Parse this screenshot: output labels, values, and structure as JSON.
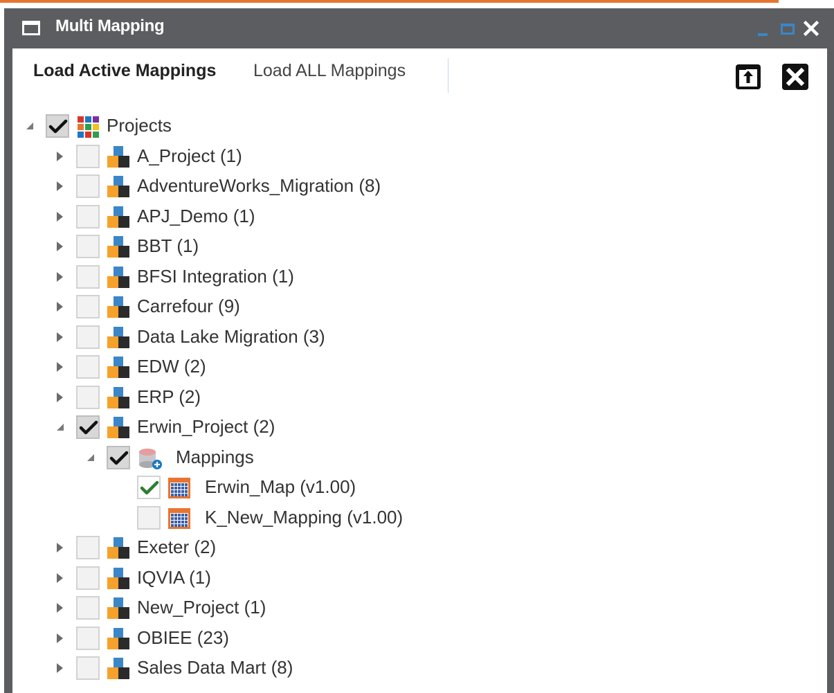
{
  "window": {
    "title": "Multi Mapping"
  },
  "tabs": {
    "active": "Load Active Mappings",
    "inactive": "Load ALL Mappings"
  },
  "tree": {
    "root": {
      "label": "Projects",
      "checked": true,
      "expanded": true
    },
    "projects": [
      {
        "label": "A_Project (1)",
        "checked": false,
        "expanded": false
      },
      {
        "label": "AdventureWorks_Migration (8)",
        "checked": false,
        "expanded": false
      },
      {
        "label": "APJ_Demo (1)",
        "checked": false,
        "expanded": false
      },
      {
        "label": "BBT (1)",
        "checked": false,
        "expanded": false
      },
      {
        "label": "BFSI Integration (1)",
        "checked": false,
        "expanded": false
      },
      {
        "label": "Carrefour (9)",
        "checked": false,
        "expanded": false
      },
      {
        "label": "Data Lake Migration (3)",
        "checked": false,
        "expanded": false
      },
      {
        "label": "EDW (2)",
        "checked": false,
        "expanded": false
      },
      {
        "label": "ERP (2)",
        "checked": false,
        "expanded": false
      },
      {
        "label": "Erwin_Project (2)",
        "checked": true,
        "expanded": true
      },
      {
        "label": "Exeter (2)",
        "checked": false,
        "expanded": false
      },
      {
        "label": "IQVIA (1)",
        "checked": false,
        "expanded": false
      },
      {
        "label": "New_Project (1)",
        "checked": false,
        "expanded": false
      },
      {
        "label": "OBIEE (23)",
        "checked": false,
        "expanded": false
      },
      {
        "label": "Sales Data Mart (8)",
        "checked": false,
        "expanded": false
      }
    ],
    "mappings_folder": {
      "label": "Mappings",
      "checked": true,
      "expanded": true
    },
    "mappings": [
      {
        "label": "Erwin_Map (v1.00)",
        "checked": true
      },
      {
        "label": "K_New_Mapping (v1.00)",
        "checked": false
      }
    ]
  },
  "colors": {
    "titlebar": "#5c5d60",
    "accent_orange": "#e8742f",
    "window_control_blue": "#3b86c6",
    "leaf_check_green": "#2e7d32"
  },
  "icons": {
    "window": "window-icon",
    "minimize": "minimize-icon",
    "maximize": "maximize-icon",
    "close": "close-icon",
    "export": "export-icon",
    "close_panel": "close-panel-icon",
    "root": "projects-grid-icon",
    "project": "project-icon",
    "mappings_folder": "database-mappings-icon",
    "mapping": "mapping-table-icon"
  }
}
